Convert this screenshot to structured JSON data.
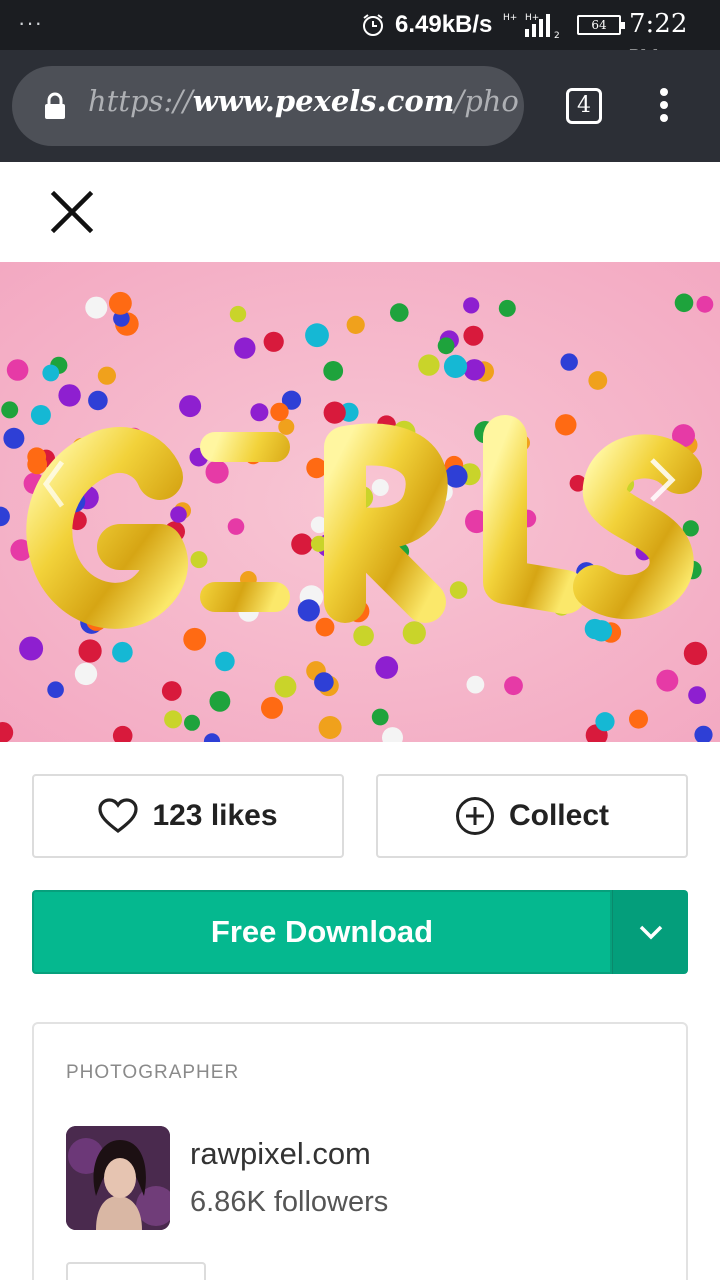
{
  "status_bar": {
    "menu_dots": "···",
    "speed": "6.49kB/s",
    "battery": "64",
    "time": "7:22",
    "ampm": "PM",
    "icons": [
      "alarm-icon",
      "signal-icon",
      "battery-icon"
    ]
  },
  "browser": {
    "url_prefix": "https://",
    "url_domain": "www.pexels.com",
    "url_path": "/photo/gol",
    "tab_count": "4",
    "icons": [
      "lock-icon",
      "overflow-menu-icon"
    ]
  },
  "photo": {
    "subject": "GIRLS"
  },
  "actions": {
    "likes_label": "123 likes",
    "collect_label": "Collect",
    "download_label": "Free Download"
  },
  "photographer": {
    "section_label": "PHOTOGRAPHER",
    "name": "rawpixel.com",
    "followers": "6.86K followers"
  },
  "colors": {
    "accent": "#05b88f",
    "accent_dark": "#049e7b",
    "statusbar": "#1b1d21",
    "browserbar": "#2c2f36",
    "photo_bg": "#f6b8cc"
  }
}
